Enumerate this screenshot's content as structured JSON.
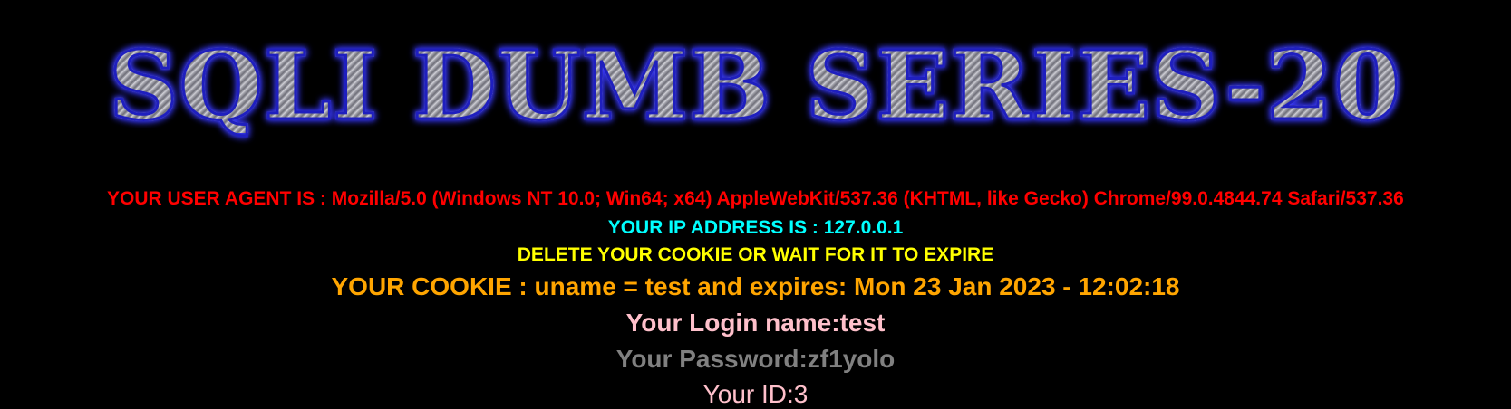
{
  "header": {
    "title": "SQLI DUMB SERIES-20"
  },
  "info": {
    "user_agent": "YOUR USER AGENT IS : Mozilla/5.0 (Windows NT 10.0; Win64; x64) AppleWebKit/537.36 (KHTML, like Gecko) Chrome/99.0.4844.74 Safari/537.36",
    "ip_address": "YOUR IP ADDRESS IS : 127.0.0.1",
    "delete_notice": "DELETE YOUR COOKIE OR WAIT FOR IT TO EXPIRE",
    "cookie": "YOUR COOKIE : uname = test and expires: Mon 23 Jan 2023 - 12:02:18",
    "login_name": "Your Login name:test",
    "password": "Your Password:zf1yolo",
    "id": "Your ID:3"
  },
  "colors": {
    "background": "#000000",
    "user_agent": "#ff0000",
    "ip_address": "#00ffff",
    "delete_notice": "#ffff00",
    "cookie": "#ffa500",
    "login_name": "#ffc0cb",
    "password": "#808080",
    "id": "#ffc0cb"
  }
}
